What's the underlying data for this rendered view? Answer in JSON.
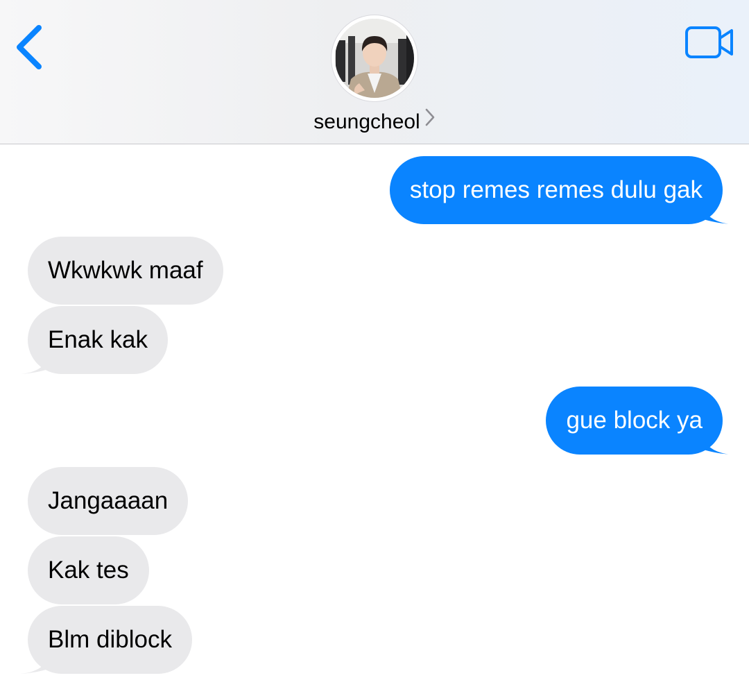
{
  "header": {
    "contact_name": "seungcheol",
    "back_icon": "chevron-left-icon",
    "video_icon": "video-camera-icon",
    "accent_color": "#0a84ff"
  },
  "messages": [
    {
      "direction": "sent",
      "text": "stop remes remes dulu gak"
    },
    {
      "direction": "received",
      "text": "Wkwkwk maaf"
    },
    {
      "direction": "received",
      "text": "Enak kak"
    },
    {
      "direction": "sent",
      "text": "gue block ya"
    },
    {
      "direction": "received",
      "text": "Jangaaaan"
    },
    {
      "direction": "received",
      "text": "Kak tes"
    },
    {
      "direction": "received",
      "text": "Blm diblock"
    }
  ],
  "colors": {
    "sent_bubble": "#0a84ff",
    "received_bubble": "#e9e9eb"
  }
}
